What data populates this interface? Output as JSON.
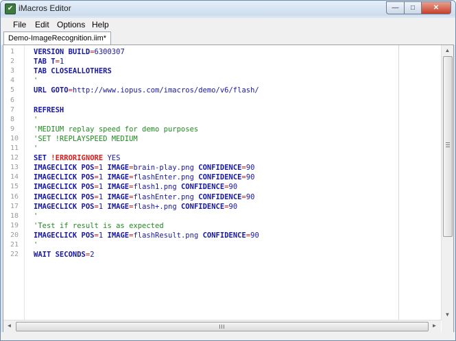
{
  "window": {
    "title": "iMacros Editor",
    "icon": "imacros-app-icon"
  },
  "controls": {
    "minimize": "—",
    "maximize": "□",
    "close": "✕"
  },
  "menu": [
    "File",
    "Edit",
    "Options",
    "Help"
  ],
  "tab": {
    "label": "Demo-ImageRecognition.iim*"
  },
  "line_numbers": [
    "1",
    "2",
    "3",
    "4",
    "5",
    "6",
    "7",
    "8",
    "9",
    "10",
    "11",
    "12",
    "13",
    "14",
    "15",
    "16",
    "17",
    "18",
    "19",
    "20",
    "21",
    "22"
  ],
  "code_lines": [
    [
      {
        "t": "VERSION BUILD",
        "c": "kw"
      },
      {
        "t": "=",
        "c": "op"
      },
      {
        "t": "6300307",
        "c": "val"
      }
    ],
    [
      {
        "t": "TAB T",
        "c": "kw"
      },
      {
        "t": "=",
        "c": "op"
      },
      {
        "t": "1",
        "c": "val"
      }
    ],
    [
      {
        "t": "TAB CLOSEALLOTHERS",
        "c": "kw"
      }
    ],
    [
      {
        "t": "'",
        "c": "com"
      }
    ],
    [
      {
        "t": "URL GOTO",
        "c": "kw"
      },
      {
        "t": "=",
        "c": "op"
      },
      {
        "t": "http://www.iopus.com/imacros/demo/v6/flash/",
        "c": "val"
      }
    ],
    [],
    [
      {
        "t": "REFRESH",
        "c": "kw"
      }
    ],
    [
      {
        "t": "'",
        "c": "com"
      }
    ],
    [
      {
        "t": "'MEDIUM replay speed for demo purposes",
        "c": "com"
      }
    ],
    [
      {
        "t": "'SET !REPLAYSPEED MEDIUM",
        "c": "com"
      }
    ],
    [
      {
        "t": "'",
        "c": "com"
      }
    ],
    [
      {
        "t": "SET ",
        "c": "kw"
      },
      {
        "t": "!ERRORIGNORE",
        "c": "err"
      },
      {
        "t": " YES",
        "c": "val"
      }
    ],
    [
      {
        "t": "IMAGECLICK POS",
        "c": "kw"
      },
      {
        "t": "=",
        "c": "op"
      },
      {
        "t": "1 ",
        "c": "val"
      },
      {
        "t": "IMAGE",
        "c": "kw"
      },
      {
        "t": "=",
        "c": "op"
      },
      {
        "t": "brain-play.png ",
        "c": "val"
      },
      {
        "t": "CONFIDENCE",
        "c": "kw"
      },
      {
        "t": "=",
        "c": "op"
      },
      {
        "t": "90",
        "c": "val"
      }
    ],
    [
      {
        "t": "IMAGECLICK POS",
        "c": "kw"
      },
      {
        "t": "=",
        "c": "op"
      },
      {
        "t": "1 ",
        "c": "val"
      },
      {
        "t": "IMAGE",
        "c": "kw"
      },
      {
        "t": "=",
        "c": "op"
      },
      {
        "t": "flashEnter.png ",
        "c": "val"
      },
      {
        "t": "CONFIDENCE",
        "c": "kw"
      },
      {
        "t": "=",
        "c": "op"
      },
      {
        "t": "90",
        "c": "val"
      }
    ],
    [
      {
        "t": "IMAGECLICK POS",
        "c": "kw"
      },
      {
        "t": "=",
        "c": "op"
      },
      {
        "t": "1 ",
        "c": "val"
      },
      {
        "t": "IMAGE",
        "c": "kw"
      },
      {
        "t": "=",
        "c": "op"
      },
      {
        "t": "flash1.png ",
        "c": "val"
      },
      {
        "t": "CONFIDENCE",
        "c": "kw"
      },
      {
        "t": "=",
        "c": "op"
      },
      {
        "t": "90",
        "c": "val"
      }
    ],
    [
      {
        "t": "IMAGECLICK POS",
        "c": "kw"
      },
      {
        "t": "=",
        "c": "op"
      },
      {
        "t": "1 ",
        "c": "val"
      },
      {
        "t": "IMAGE",
        "c": "kw"
      },
      {
        "t": "=",
        "c": "op"
      },
      {
        "t": "flashEnter.png ",
        "c": "val"
      },
      {
        "t": "CONFIDENCE",
        "c": "kw"
      },
      {
        "t": "=",
        "c": "op"
      },
      {
        "t": "90",
        "c": "val"
      }
    ],
    [
      {
        "t": "IMAGECLICK POS",
        "c": "kw"
      },
      {
        "t": "=",
        "c": "op"
      },
      {
        "t": "1 ",
        "c": "val"
      },
      {
        "t": "IMAGE",
        "c": "kw"
      },
      {
        "t": "=",
        "c": "op"
      },
      {
        "t": "flash+.png ",
        "c": "val"
      },
      {
        "t": "CONFIDENCE",
        "c": "kw"
      },
      {
        "t": "=",
        "c": "op"
      },
      {
        "t": "90",
        "c": "val"
      }
    ],
    [
      {
        "t": "'",
        "c": "com"
      }
    ],
    [
      {
        "t": "'Test if result is as expected",
        "c": "com"
      }
    ],
    [
      {
        "t": "IMAGECLICK POS",
        "c": "kw"
      },
      {
        "t": "=",
        "c": "op"
      },
      {
        "t": "1 ",
        "c": "val"
      },
      {
        "t": "IMAGE",
        "c": "kw"
      },
      {
        "t": "=",
        "c": "op"
      },
      {
        "t": "flashResult.png ",
        "c": "val"
      },
      {
        "t": "CONFIDENCE",
        "c": "kw"
      },
      {
        "t": "=",
        "c": "op"
      },
      {
        "t": "90",
        "c": "val"
      }
    ],
    [
      {
        "t": "'",
        "c": "com"
      }
    ],
    [
      {
        "t": "WAIT SECONDS",
        "c": "kw"
      },
      {
        "t": "=",
        "c": "op"
      },
      {
        "t": "2",
        "c": "val"
      }
    ]
  ],
  "scrollbar": {
    "up": "▲",
    "down": "▼",
    "left": "◄",
    "right": "►"
  },
  "colors": {
    "keyword": "#1616a8",
    "operator": "#d81c1c",
    "comment": "#1f8a1f",
    "error_var": "#d81c1c"
  }
}
